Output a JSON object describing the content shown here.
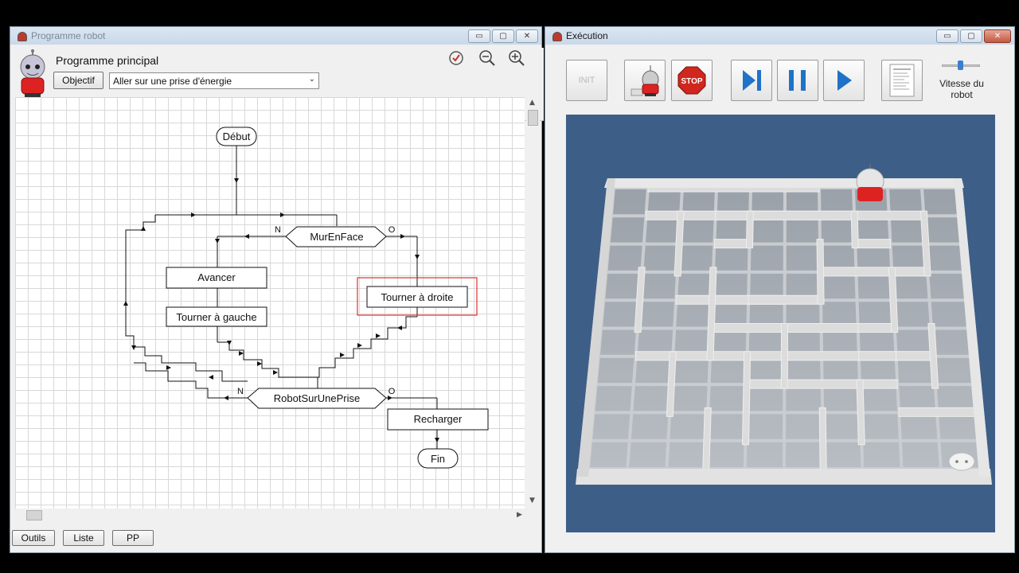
{
  "left_window": {
    "title": "Programme robot",
    "program_title": "Programme principal",
    "objective_button": "Objectif",
    "objective_select": "Aller sur une prise d'énergie",
    "bottom_buttons": [
      "Outils",
      "Liste",
      "PP"
    ],
    "flowchart": {
      "start": "Début",
      "condition_wall": "MurEnFace",
      "branch_no": "N",
      "branch_yes": "O",
      "action_forward": "Avancer",
      "action_left": "Tourner à gauche",
      "action_right": "Tourner à droite",
      "condition_outlet": "RobotSurUnePrise",
      "action_recharge": "Recharger",
      "end": "Fin"
    }
  },
  "right_window": {
    "title": "Exécution",
    "init_label": "INIT",
    "stop_label": "STOP",
    "speed_label_line1": "Vitesse du",
    "speed_label_line2": "robot"
  },
  "colors": {
    "maze_background": "#3d5e87",
    "stop_red": "#d0261e",
    "play_blue": "#1e73c8",
    "highlight_red": "#e03030"
  }
}
